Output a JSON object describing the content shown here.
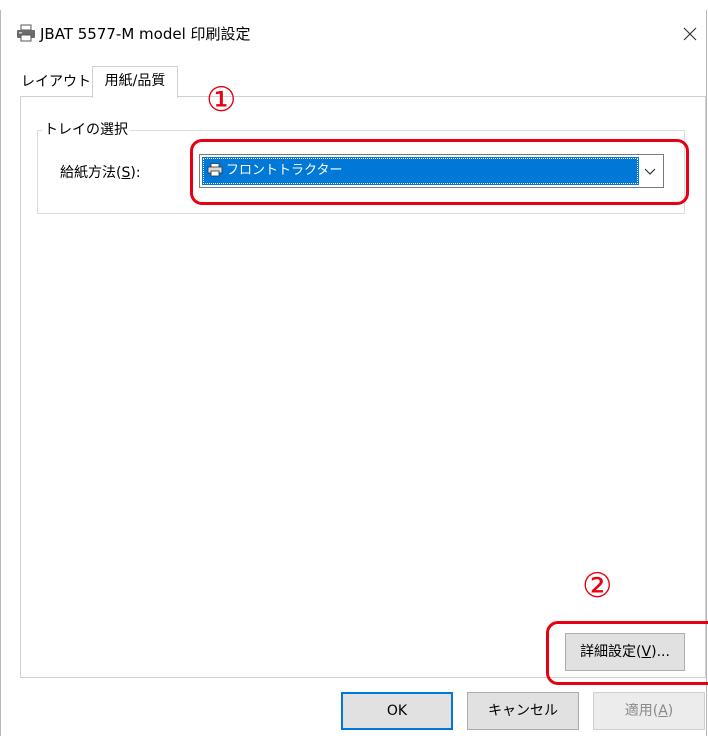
{
  "window": {
    "title": "JBAT 5577-M model 印刷設定",
    "icon": "printer-icon",
    "close_icon": "close-icon"
  },
  "tabs": [
    {
      "label": "レイアウト",
      "selected": false
    },
    {
      "label": "用紙/品質",
      "selected": true
    }
  ],
  "tray_group": {
    "legend": "トレイの選択",
    "feed_label_prefix": "給紙方法(",
    "feed_label_accel": "S",
    "feed_label_suffix": "):",
    "feed_value": "フロントトラクター",
    "feed_icon": "printer-small-icon",
    "dropdown_icon": "chevron-down-icon"
  },
  "advanced_button": {
    "label_prefix": "詳細設定(",
    "accel": "V",
    "label_suffix": ")..."
  },
  "dialog_buttons": {
    "ok": "OK",
    "cancel": "キャンセル",
    "apply_prefix": "適用(",
    "apply_accel": "A",
    "apply_suffix": ")"
  },
  "callouts": {
    "one": "①",
    "two": "②",
    "color": "#e60012"
  },
  "colors": {
    "accent": "#0078d7",
    "callout": "#e60012"
  }
}
